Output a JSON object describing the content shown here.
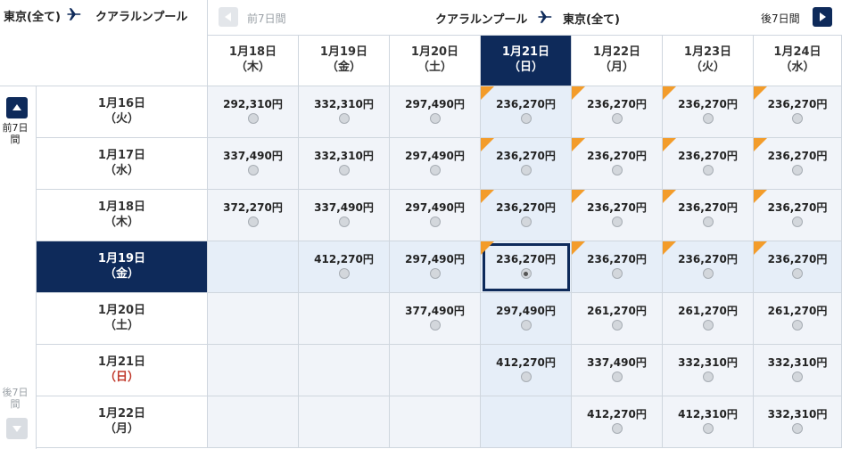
{
  "outbound": {
    "from": "東京(全て)",
    "to": "クアラルンプール"
  },
  "return": {
    "from": "クアラルンプール",
    "to": "東京(全て)"
  },
  "nav": {
    "prev_week": "前7日間",
    "next_week": "後7日間"
  },
  "side": {
    "prev_label": "前7日間",
    "next_label": "後7日間"
  },
  "columns": [
    {
      "date": "1月18日",
      "dow": "（木）"
    },
    {
      "date": "1月19日",
      "dow": "（金）"
    },
    {
      "date": "1月20日",
      "dow": "（土）"
    },
    {
      "date": "1月21日",
      "dow": "（日）"
    },
    {
      "date": "1月22日",
      "dow": "（月）"
    },
    {
      "date": "1月23日",
      "dow": "（火）"
    },
    {
      "date": "1月24日",
      "dow": "（水）"
    }
  ],
  "rows": [
    {
      "date": "1月16日",
      "dow": "（火）",
      "prices": [
        "292,310円",
        "332,310円",
        "297,490円",
        "236,270円",
        "236,270円",
        "236,270円",
        "236,270円"
      ]
    },
    {
      "date": "1月17日",
      "dow": "（水）",
      "prices": [
        "337,490円",
        "332,310円",
        "297,490円",
        "236,270円",
        "236,270円",
        "236,270円",
        "236,270円"
      ]
    },
    {
      "date": "1月18日",
      "dow": "（木）",
      "prices": [
        "372,270円",
        "337,490円",
        "297,490円",
        "236,270円",
        "236,270円",
        "236,270円",
        "236,270円"
      ]
    },
    {
      "date": "1月19日",
      "dow": "（金）",
      "prices": [
        "",
        "412,270円",
        "297,490円",
        "236,270円",
        "236,270円",
        "236,270円",
        "236,270円"
      ]
    },
    {
      "date": "1月20日",
      "dow": "（土）",
      "prices": [
        "",
        "",
        "377,490円",
        "297,490円",
        "261,270円",
        "261,270円",
        "261,270円"
      ]
    },
    {
      "date": "1月21日",
      "dow": "（日）",
      "prices": [
        "",
        "",
        "",
        "412,270円",
        "337,490円",
        "332,310円",
        "332,310円"
      ]
    },
    {
      "date": "1月22日",
      "dow": "（月）",
      "prices": [
        "",
        "",
        "",
        "",
        "412,270円",
        "412,310円",
        "332,310円"
      ]
    }
  ],
  "selected_column": 3,
  "selected_row": 3,
  "cheapest_price": "236,270円",
  "colors": {
    "navy": "#0e2a5a",
    "orange_flag": "#f39c2a",
    "sunday_red": "#c0392b"
  }
}
